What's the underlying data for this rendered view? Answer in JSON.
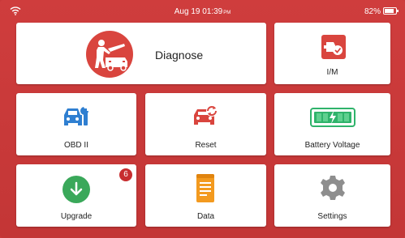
{
  "status_bar": {
    "time": "Aug 19  01:39",
    "ampm": "PM",
    "battery_percent": "82%",
    "battery_level": 0.82
  },
  "tiles": {
    "diagnose": {
      "label": "Diagnose",
      "icon": "diagnose-car-icon",
      "color": "#d9453e"
    },
    "im": {
      "label": "I/M",
      "icon": "im-readiness-icon",
      "color": "#d9453e"
    },
    "obd2": {
      "label": "OBD II",
      "icon": "obd-car-wrench-icon",
      "color": "#2f7fd1"
    },
    "reset": {
      "label": "Reset",
      "icon": "car-reset-icon",
      "color": "#d9453e"
    },
    "battery": {
      "label": "Battery Voltage",
      "icon": "battery-voltage-icon",
      "color": "#2fb36b"
    },
    "upgrade": {
      "label": "Upgrade",
      "icon": "download-arrow-icon",
      "color": "#3aa85a",
      "badge": "6"
    },
    "data": {
      "label": "Data",
      "icon": "document-icon",
      "color": "#f39a1f"
    },
    "settings": {
      "label": "Settings",
      "icon": "gear-icon",
      "color": "#8e8e8e"
    }
  }
}
